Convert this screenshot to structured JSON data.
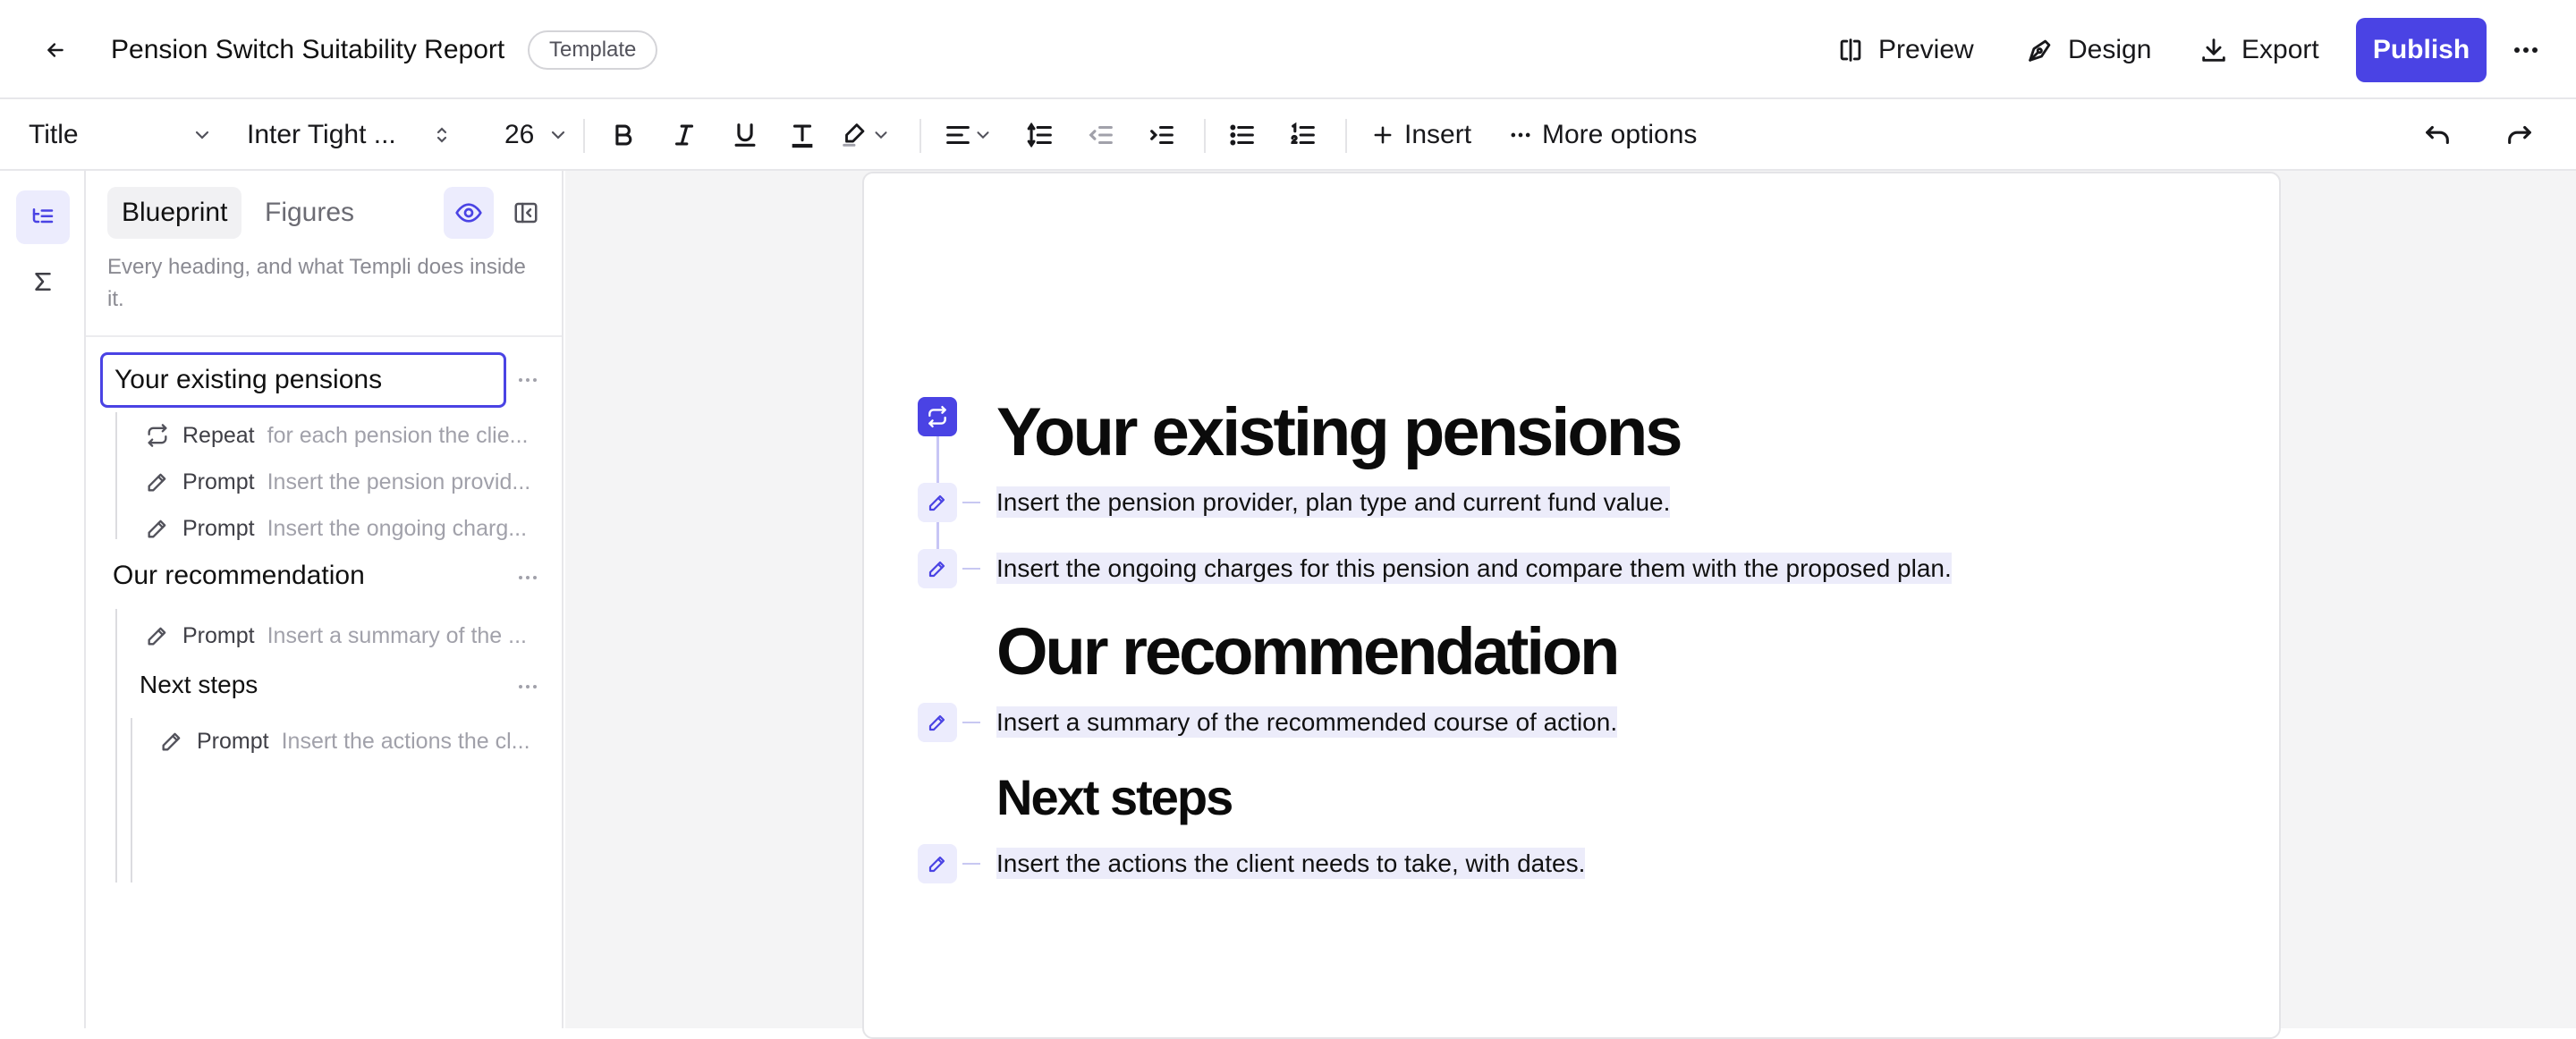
{
  "header": {
    "title": "Pension Switch Suitability Report",
    "badge": "Template",
    "preview": "Preview",
    "design": "Design",
    "export": "Export",
    "publish": "Publish"
  },
  "toolbar": {
    "style": "Title",
    "font": "Inter Tight ...",
    "size": "26",
    "insert": "Insert",
    "more_options": "More options"
  },
  "panel": {
    "tabs": [
      "Blueprint",
      "Figures"
    ],
    "description": "Every heading, and what Templi does inside it.",
    "tree": [
      {
        "level": 1,
        "label": "Your existing pensions",
        "selected": true
      },
      {
        "kind": "Repeat",
        "text": "for each pension the clie..."
      },
      {
        "kind": "Prompt",
        "text": "Insert the pension provid..."
      },
      {
        "kind": "Prompt",
        "text": "Insert the ongoing charg..."
      },
      {
        "level": 1,
        "label": "Our recommendation"
      },
      {
        "kind": "Prompt",
        "text": "Insert a summary of the ..."
      },
      {
        "level": 2,
        "label": "Next steps"
      },
      {
        "kind": "Prompt",
        "text": "Insert the actions the cl..."
      }
    ]
  },
  "document": {
    "h1_existing": "Your existing pensions",
    "p1": "Insert the pension provider, plan type and current fund value.",
    "p2": "Insert the ongoing charges for this pension and compare them with the proposed plan.",
    "h1_recommendation": "Our recommendation",
    "p3": "Insert a summary of the recommended course of action.",
    "h2_next": "Next steps",
    "p4": "Insert the actions the client needs to take, with dates."
  },
  "colors": {
    "accent": "#4a43e4",
    "highlight": "#ececfa",
    "canvas_bg": "#f4f4f5"
  }
}
